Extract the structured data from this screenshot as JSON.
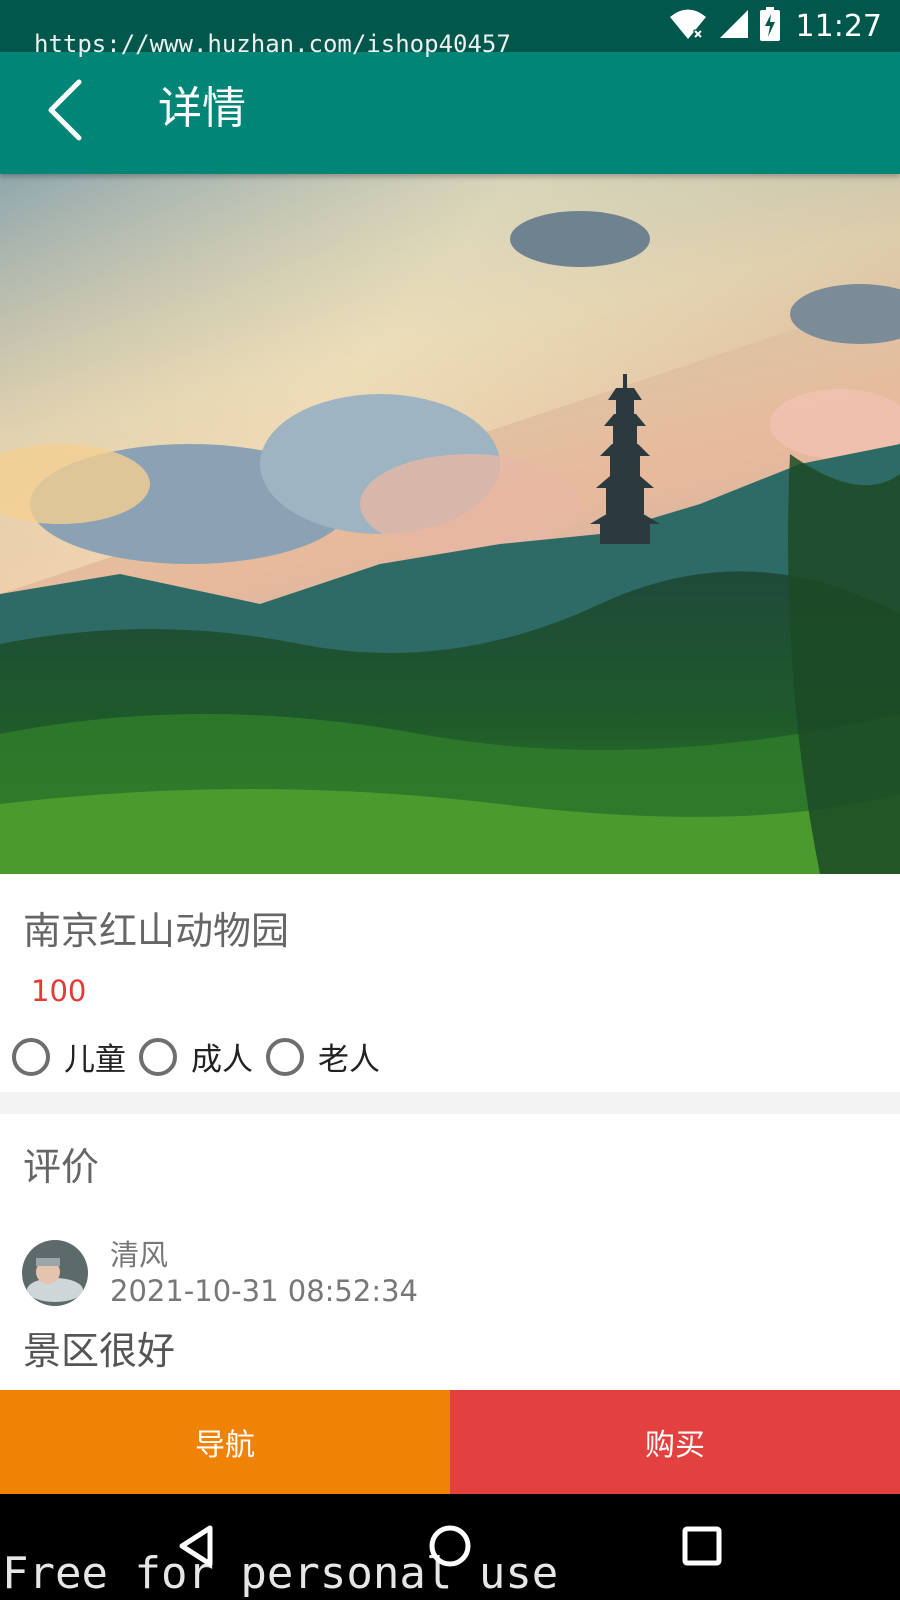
{
  "status_bar": {
    "time": "11:27",
    "icons": [
      "wifi-icon",
      "cell-signal-icon",
      "battery-charging-icon"
    ]
  },
  "watermarks": {
    "url": "https://www.huzhan.com/ishop40457",
    "footer": "Free for personal use"
  },
  "app_bar": {
    "back_icon": "arrow-back-icon",
    "title": "详情"
  },
  "hero": {
    "icon": "landscape-pagoda-photo"
  },
  "detail": {
    "name": "南京红山动物园",
    "price": "100",
    "ticket_options": [
      {
        "label": "儿童",
        "selected": false
      },
      {
        "label": "成人",
        "selected": false
      },
      {
        "label": "老人",
        "selected": false
      }
    ]
  },
  "reviews": {
    "heading": "评价",
    "items": [
      {
        "user": "清风",
        "time": "2021-10-31 08:52:34",
        "text": "景区很好"
      }
    ]
  },
  "actions": {
    "navigate": "导航",
    "buy": "购买"
  },
  "colors": {
    "status_bar": "#00574b",
    "app_bar": "#008577",
    "price": "#e53935",
    "navigate_button": "#f08205",
    "buy_button": "#e34040"
  },
  "system_nav": {
    "icons": [
      "back-triangle-icon",
      "home-circle-icon",
      "recents-square-icon"
    ]
  }
}
